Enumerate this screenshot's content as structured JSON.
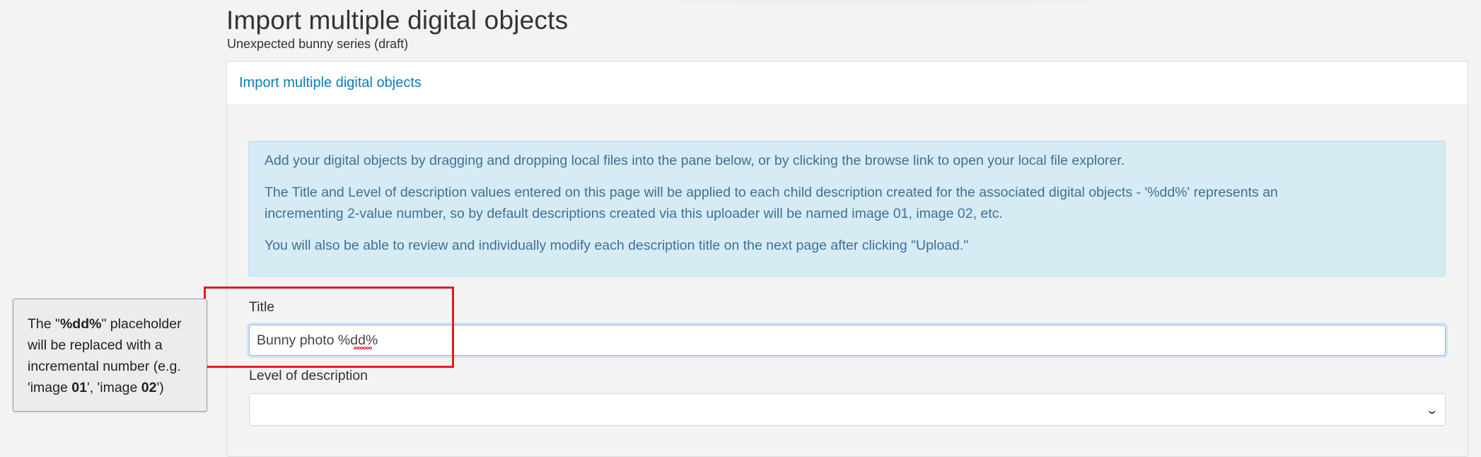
{
  "page": {
    "title": "Import multiple digital objects",
    "subtitle": "Unexpected bunny series (draft)"
  },
  "panel": {
    "header_link": "Import multiple digital objects"
  },
  "info": {
    "paragraph1": "Add your digital objects by dragging and dropping local files into the pane below, or by clicking the browse link to open your local file explorer.",
    "paragraph2_line1": "The Title and Level of description values entered on this page will be applied to each child description created for the associated digital objects - '%dd%' represents an",
    "paragraph2_line2": "incrementing 2-value number, so by default descriptions created via this uploader will be named image 01, image 02, etc.",
    "paragraph3": "You will also be able to review and individually modify each description title on the next page after clicking \"Upload.\""
  },
  "form": {
    "title_label": "Title",
    "title_value": "Bunny photo %dd%",
    "level_label": "Level of description",
    "level_value": ""
  },
  "callout": {
    "t1": "The \"",
    "t2": "%dd%",
    "t3": "\" placeholder will be replaced with a incremental number (e.g. 'image ",
    "t4": "01",
    "t5": "', 'image ",
    "t6": "02",
    "t7": "')"
  },
  "icons": {
    "select_chevron": "chevron-down-icon"
  },
  "colors": {
    "link": "#0d7cb6",
    "info_bg": "#d6ebf4",
    "info_text": "#407196",
    "highlight": "#e51c1c"
  }
}
